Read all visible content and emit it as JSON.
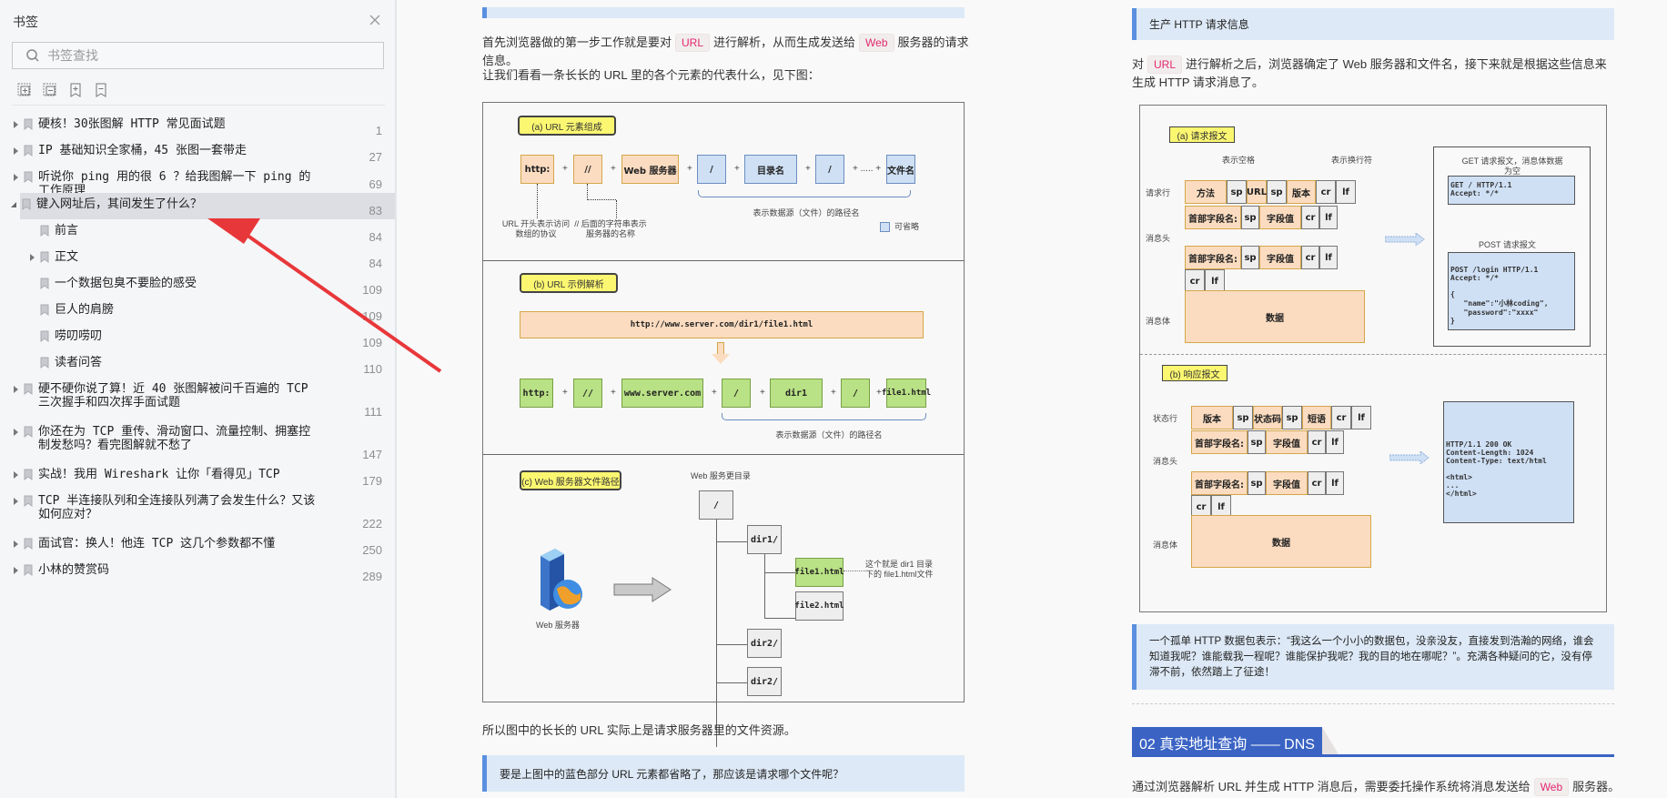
{
  "sidebar": {
    "title": "书签",
    "search_placeholder": "书签查找",
    "tools": [
      "expand-all-icon",
      "collapse-all-icon",
      "add-bookmark-icon",
      "remove-bookmark-icon"
    ],
    "items": [
      {
        "label": "硬核！30张图解 HTTP 常见面试题",
        "page": "1",
        "level": 0,
        "expandable": true,
        "expanded": false
      },
      {
        "label": "IP 基础知识全家桶，45 张图一套带走",
        "page": "27",
        "level": 0,
        "expandable": true,
        "expanded": false
      },
      {
        "label": "听说你 ping 用的很 6 ？给我图解一下 ping 的工作原理",
        "page": "69",
        "level": 0,
        "expandable": true,
        "expanded": false
      },
      {
        "label": "键入网址后，其间发生了什么？",
        "page": "83",
        "level": 0,
        "expandable": true,
        "expanded": true,
        "selected": true
      },
      {
        "label": "前言",
        "page": "84",
        "level": 1,
        "expandable": false
      },
      {
        "label": "正文",
        "page": "84",
        "level": 1,
        "expandable": true,
        "expanded": false
      },
      {
        "label": "一个数据包臭不要脸的感受",
        "page": "109",
        "level": 1,
        "expandable": false
      },
      {
        "label": "巨人的肩膀",
        "page": "109",
        "level": 1,
        "expandable": false
      },
      {
        "label": "唠叨唠叨",
        "page": "109",
        "level": 1,
        "expandable": false
      },
      {
        "label": "读者问答",
        "page": "110",
        "level": 1,
        "expandable": false
      },
      {
        "label": "硬不硬你说了算！近 40 张图解被问千百遍的 TCP 三次握手和四次挥手面试题",
        "page": "111",
        "level": 0,
        "expandable": true,
        "expanded": false
      },
      {
        "label": "你还在为 TCP 重传、滑动窗口、流量控制、拥塞控制发愁吗？看完图解就不愁了",
        "page": "147",
        "level": 0,
        "expandable": true,
        "expanded": false
      },
      {
        "label": "实战！我用 Wireshark 让你「看得见」TCP",
        "page": "179",
        "level": 0,
        "expandable": true,
        "expanded": false
      },
      {
        "label": "TCP 半连接队列和全连接队列满了会发生什么？又该如何应对？",
        "page": "222",
        "level": 0,
        "expandable": true,
        "expanded": false
      },
      {
        "label": "面试官：换人！他连 TCP 这几个参数都不懂",
        "page": "250",
        "level": 0,
        "expandable": true,
        "expanded": false
      },
      {
        "label": "小林的赞赏码",
        "page": "289",
        "level": 0,
        "expandable": true,
        "expanded": false
      }
    ]
  },
  "left_page": {
    "p1_pre": "首先浏览器做的第一步工作就是要对",
    "p1_code1": "URL",
    "p1_mid": "进行解析，从而生成发送给",
    "p1_code2": "Web",
    "p1_post": "服务器的请求信息。",
    "p2": "让我们看看一条长长的 URL 里的各个元素的代表什么，见下图：",
    "fig": {
      "a_title": "(a)   URL 元素组成",
      "a_boxes": [
        "http:",
        "//",
        "Web 服务器",
        "/",
        "目录名",
        "/",
        "文件名"
      ],
      "a_ellipsis": "+ ..... +",
      "a_note1": "URL 开头表示访问数组的协议",
      "a_note2": "// 后面的字符串表示服务器的名称",
      "a_brace": "表示数据源（文件）的路径名",
      "a_legend": "可省略",
      "b_title": "(b)   URL 示例解析",
      "b_url": "http://www.server.com/dir1/file1.html",
      "b_boxes": [
        "http:",
        "//",
        "www.server.com",
        "/",
        "dir1",
        "/",
        "file1.html"
      ],
      "b_brace": "表示数据源（文件）的路径名",
      "c_title": "(c)   Web 服务器文件路径",
      "c_root_label": "Web 服务更目录",
      "c_root": "/",
      "c_dir1": "dir1/",
      "c_file1": "file1.html",
      "c_file2": "file2.html",
      "c_dir2a": "dir2/",
      "c_dir2b": "dir2/",
      "c_note": "这个就是 dir1 目录下的 file1.html文件",
      "c_server": "Web 服务器",
      "plus": "+"
    },
    "p3": "所以图中的长长的 URL 实际上是请求服务器里的文件资源。",
    "quote": "要是上图中的蓝色部分 URL 元素都省略了，那应该是请求哪个文件呢？"
  },
  "right_page": {
    "quote_top": "生产 HTTP 请求信息",
    "p1_pre": "对",
    "p1_code": "URL",
    "p1_post": "进行解析之后，浏览器确定了 Web 服务器和文件名，接下来就是根据这些信息来生成 HTTP 请求消息了。",
    "fig": {
      "a_title": "(a) 请求报文",
      "space_label": "表示空格",
      "newline_label": "表示换行符",
      "req_line": "请求行",
      "headers": "消息头",
      "body": "消息体",
      "req_row": [
        "方法",
        "sp",
        "URL",
        "sp",
        "版本",
        "cr",
        "lf"
      ],
      "hdr_row": [
        "首部字段名:",
        "sp",
        "字段值",
        "cr",
        "lf"
      ],
      "crlf": [
        "cr",
        "lf"
      ],
      "data": "数据",
      "get_title": "GET 请求报文，消息体数据为空",
      "get_body": "GET / HTTP/1.1\nAccept: */*",
      "post_title": "POST 请求报文",
      "post_body": "POST /login HTTP/1.1\nAccept: */*\n\n{\n   \"name\":\"小林coding\",\n   \"password\":\"xxxx\"\n}",
      "b_title": "(b) 响应报文",
      "status_line": "状态行",
      "resp_row": [
        "版本",
        "sp",
        "状态码",
        "sp",
        "短语",
        "cr",
        "lf"
      ],
      "resp_body": "HTTP/1.1 200 OK\nContent-Length: 1024\nContent-Type: text/html\n\n<html>\n...\n</html>"
    },
    "quote2": "一个孤单 HTTP 数据包表示：“我这么一个小小的数据包，没亲没友，直接发到浩瀚的网络，谁会知道我呢？谁能载我一程呢？谁能保护我呢？我的目的地在哪呢？”。充满各种疑问的它，没有停滞不前，依然踏上了征途！",
    "section_title": "02 真实地址查询 —— DNS",
    "p2_pre": "通过浏览器解析 URL 并生成 HTTP 消息后，需要委托操作系统将消息发送给",
    "p2_code": "Web",
    "p2_post": "服务器。"
  },
  "colors": {
    "accent": "#3a63c4",
    "quote_bg": "#dde9f6",
    "quote_bar": "#5b8fe0",
    "code_text": "#e2286e",
    "arrow": "#e8373a",
    "selected_bg": "#dcdee3"
  }
}
